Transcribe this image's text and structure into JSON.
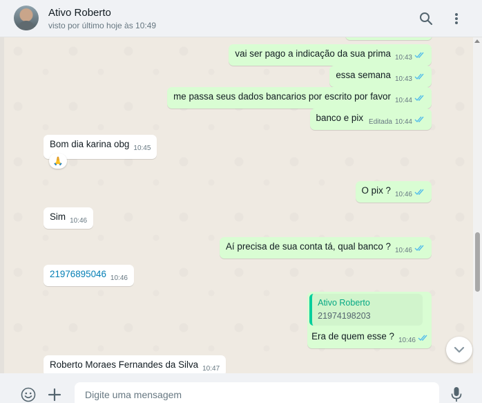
{
  "header": {
    "contact_name": "Ativo Roberto",
    "status": "visto por último hoje às 10:49",
    "icons": [
      "search-icon",
      "menu-icon"
    ]
  },
  "messages": [
    {
      "dir": "out",
      "text": "vai ser pago a indicação da sua prima",
      "time": "10:43",
      "status": "read"
    },
    {
      "dir": "out",
      "text": "essa semana",
      "time": "10:43",
      "status": "read"
    },
    {
      "dir": "out",
      "text": "me passa seus dados bancarios por escrito por favor",
      "time": "10:44",
      "status": "read"
    },
    {
      "dir": "out",
      "text": "banco e pix",
      "edited": "Editada",
      "time": "10:44",
      "status": "read"
    },
    {
      "dir": "in",
      "text": "Bom dia karina obg",
      "time": "10:45",
      "reaction": "🙏"
    },
    {
      "dir": "out",
      "text": "O pix ?",
      "time": "10:46",
      "status": "read"
    },
    {
      "dir": "in",
      "text": "Sim",
      "time": "10:46"
    },
    {
      "dir": "out",
      "text": "Aí precisa de sua conta tá, qual banco ?",
      "time": "10:46",
      "status": "read"
    },
    {
      "dir": "in",
      "text": "21976895046",
      "time": "10:46",
      "is_link": true
    },
    {
      "dir": "out",
      "quote_name": "Ativo Roberto",
      "quote_text": "21974198203",
      "text": "Era de quem esse ?",
      "time": "10:46",
      "status": "read"
    },
    {
      "dir": "in",
      "text": "Roberto Moraes Fernandes da Silva",
      "time": "10:47"
    }
  ],
  "composer": {
    "placeholder": "Digite uma mensagem",
    "icons": [
      "emoji-icon",
      "plus-icon",
      "mic-icon"
    ]
  },
  "colors": {
    "outgoing_bubble": "#d9fdd3",
    "incoming_bubble": "#ffffff",
    "read_ticks": "#53bdeb",
    "chat_background": "#efeae2",
    "header_background": "#f0f2f5"
  }
}
